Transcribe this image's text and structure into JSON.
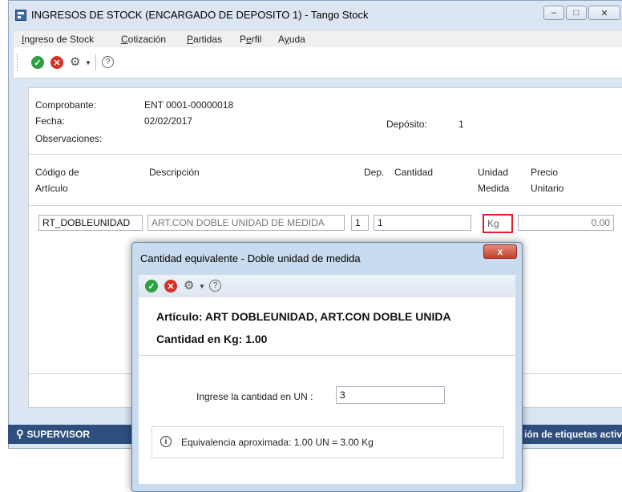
{
  "window": {
    "title": "INGRESOS DE STOCK (ENCARGADO DE DEPOSITO 1) - Tango Stock"
  },
  "menu": [
    {
      "pre": "",
      "ul": "I",
      "post": "ngreso de Stock"
    },
    {
      "pre": "",
      "ul": "C",
      "post": "otización"
    },
    {
      "pre": "",
      "ul": "P",
      "post": "artidas"
    },
    {
      "pre": "P",
      "ul": "e",
      "post": "rfil"
    },
    {
      "pre": "A",
      "ul": "y",
      "post": "uda"
    }
  ],
  "form": {
    "comprobante_label": "Comprobante:",
    "comprobante_value": "ENT   0001-00000018",
    "fecha_label": "Fecha:",
    "fecha_value": "02/02/2017",
    "deposito_label": "Depósito:",
    "deposito_value": "1",
    "observaciones_label": "Observaciones:"
  },
  "grid": {
    "headers": {
      "codigo_1": "Código de",
      "codigo_2": "Artículo",
      "descripcion": "Descripción",
      "dep": "Dep.",
      "cantidad": "Cantidad",
      "unidad_1": "Unidad",
      "unidad_2": "Medida",
      "precio_1": "Precio",
      "precio_2": "Unitario"
    },
    "row": {
      "codigo": "RT_DOBLEUNIDAD",
      "descripcion": "ART.CON DOBLE UNIDAD DE MEDIDA",
      "dep": "1",
      "cantidad": "1",
      "unidad": "Kg",
      "precio": "0.00"
    }
  },
  "statusbar": {
    "user": "SUPERVISOR",
    "right": "ión de etiquetas activ"
  },
  "dialog": {
    "title": "Cantidad equivalente - Doble unidad de medida",
    "close": "x",
    "articulo": "Artículo: ART  DOBLEUNIDAD, ART.CON DOBLE UNIDA",
    "cantidad_kg": "Cantidad en Kg: 1.00",
    "input_label": "Ingrese la cantidad en UN :",
    "input_value": "3",
    "info_text": "Equivalencia aproximada: 1.00 UN = 3.00 Kg"
  },
  "colors": {
    "ok": "#2ea043",
    "cancel": "#d93025",
    "highlight": "#e0202a",
    "statusbar": "#2e4e7e"
  }
}
